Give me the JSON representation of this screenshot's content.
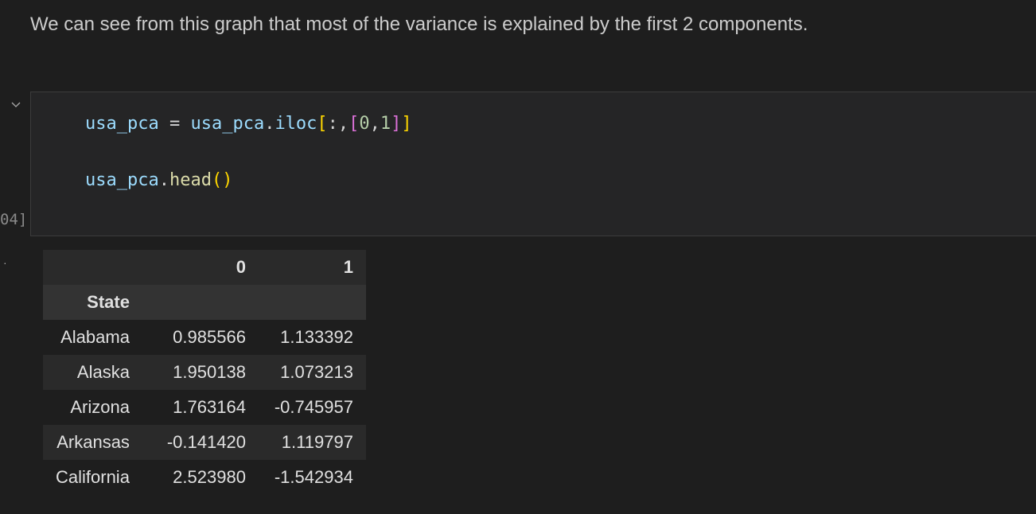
{
  "markdown": "We can see from this graph that most of the variance is explained by the first 2 components.",
  "cell": {
    "exec_count": "04]",
    "line1": {
      "var": "usa_pca",
      "eq": " = ",
      "obj": "usa_pca",
      "dot": ".",
      "method": "iloc",
      "open": "[",
      ":,": ":,",
      "open2": "[",
      "n0": "0",
      "comma": ",",
      "n1": "1",
      "close2": "]",
      "close": "]"
    },
    "line2": {
      "obj": "usa_pca",
      "dot": ".",
      "method": "head",
      "parens": "()"
    }
  },
  "output": {
    "marker": "·",
    "columns": [
      "",
      "0",
      "1"
    ],
    "index_name": "State",
    "rows": [
      [
        "Alabama",
        "0.985566",
        "1.133392"
      ],
      [
        "Alaska",
        "1.950138",
        "1.073213"
      ],
      [
        "Arizona",
        "1.763164",
        "-0.745957"
      ],
      [
        "Arkansas",
        "-0.141420",
        "1.119797"
      ],
      [
        "California",
        "2.523980",
        "-1.542934"
      ]
    ]
  }
}
